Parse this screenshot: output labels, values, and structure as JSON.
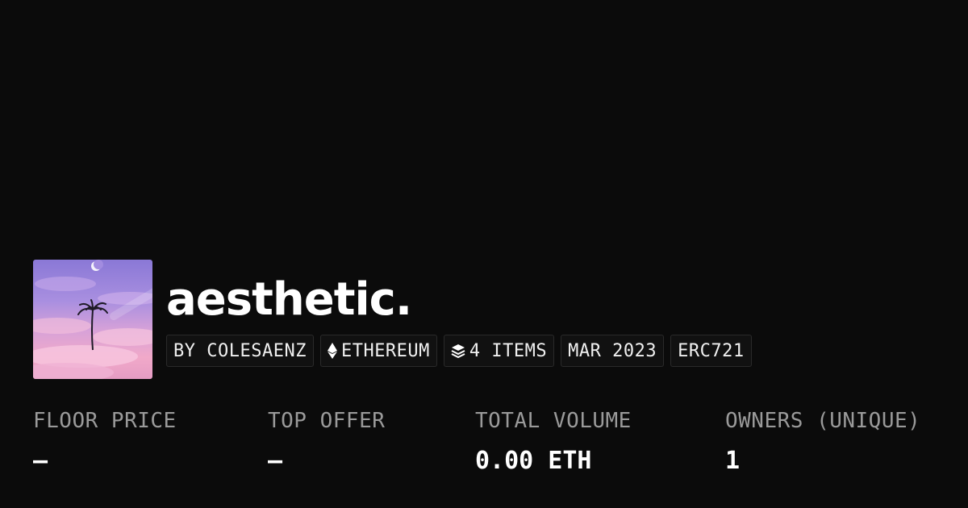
{
  "collection": {
    "name": "aesthetic.",
    "chips": [
      {
        "label": "BY COLESAENZ",
        "icon": ""
      },
      {
        "label": "ETHEREUM",
        "icon": "ethereum-icon"
      },
      {
        "label": "4 ITEMS",
        "icon": "layers-icon"
      },
      {
        "label": "MAR 2023",
        "icon": ""
      },
      {
        "label": "ERC721",
        "icon": ""
      }
    ],
    "avatar_icon": "palm-tree-sunset-image"
  },
  "stats": [
    {
      "label": "FLOOR PRICE",
      "value": "—"
    },
    {
      "label": "TOP OFFER",
      "value": "—"
    },
    {
      "label": "TOTAL VOLUME",
      "value": "0.00 ETH"
    },
    {
      "label": "OWNERS (UNIQUE)",
      "value": "1"
    }
  ],
  "colors": {
    "background": "#0b0b0b",
    "chip_background": "#111111",
    "chip_border": "#2a2a2a",
    "label_gray": "#9a9a9a",
    "text": "#ffffff"
  }
}
